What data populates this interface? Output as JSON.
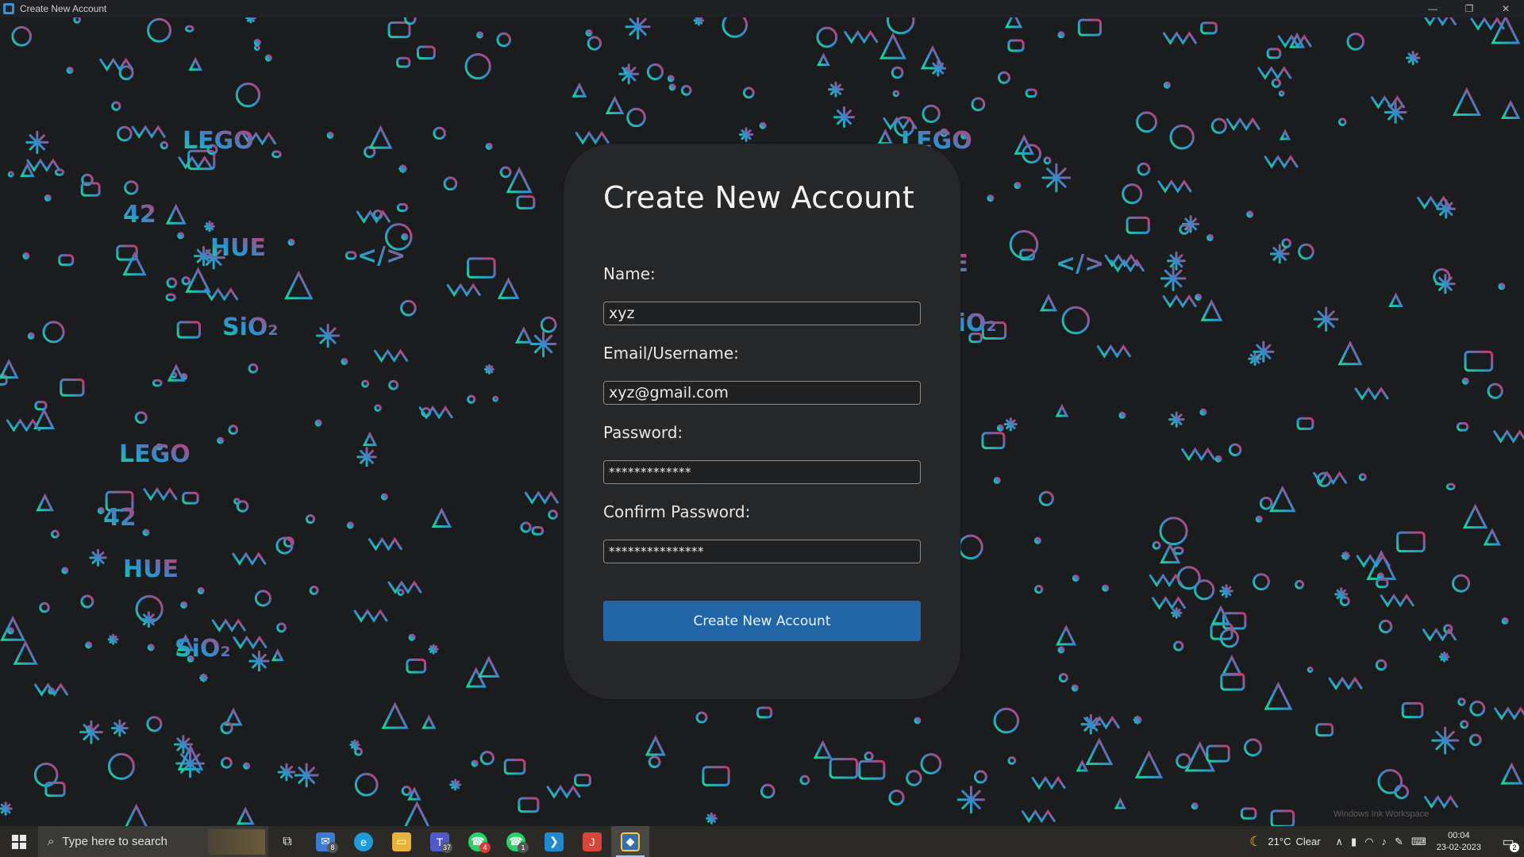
{
  "window": {
    "title": "Create New Account",
    "controls": [
      "minimize-icon",
      "restore-icon",
      "close-icon"
    ]
  },
  "background": {
    "words": [
      "LEGO",
      "HUE",
      "42",
      "SiO₂",
      "</>",
      "LEGO",
      "HUE",
      "42",
      "SiO₂",
      "</>",
      "LEGO",
      "HUE",
      "42",
      "SiO₂",
      "LEGO",
      "HUE",
      "42",
      "SiO₂"
    ],
    "gradient": {
      "left": "#1fd39a",
      "middle": "#2f8fd0",
      "right": "#d0336a"
    }
  },
  "form": {
    "title": "Create New Account",
    "fields": [
      {
        "label": "Name:",
        "value": "xyz"
      },
      {
        "label": "Email/Username:",
        "value": "xyz@gmail.com"
      },
      {
        "label": "Password:",
        "value": "*************"
      },
      {
        "label": "Confirm Password:",
        "value": "***************"
      }
    ],
    "submit_label": "Create New Account",
    "accent": "#2265a6"
  },
  "taskbar": {
    "search_placeholder": "Type here to search",
    "apps": [
      {
        "name": "task-view-icon",
        "badge": ""
      },
      {
        "name": "mail-icon",
        "badge": "8",
        "color": "#3b7bd6"
      },
      {
        "name": "edge-icon",
        "badge": "",
        "color": "#1e9bd8"
      },
      {
        "name": "file-explorer-icon",
        "badge": "",
        "color": "#e8b33a"
      },
      {
        "name": "teams-icon",
        "badge": "37",
        "color": "#5059c9"
      },
      {
        "name": "whatsapp-icon",
        "badge": "4",
        "color": "#25d366"
      },
      {
        "name": "whatsapp-business-icon",
        "badge": "1",
        "color": "#25d366"
      },
      {
        "name": "vscode-icon",
        "badge": "",
        "color": "#1f8ad2"
      },
      {
        "name": "jetbrains-icon",
        "badge": "",
        "color": "#d8453a"
      },
      {
        "name": "python-icon",
        "badge": "",
        "color": "#f2c94c"
      }
    ],
    "weather": {
      "temp": "21°C",
      "condition": "Clear"
    },
    "clock": {
      "time": "00:04",
      "date": "23-02-2023"
    },
    "notifications_badge": "2",
    "watermark": "Windows Ink Workspace"
  }
}
